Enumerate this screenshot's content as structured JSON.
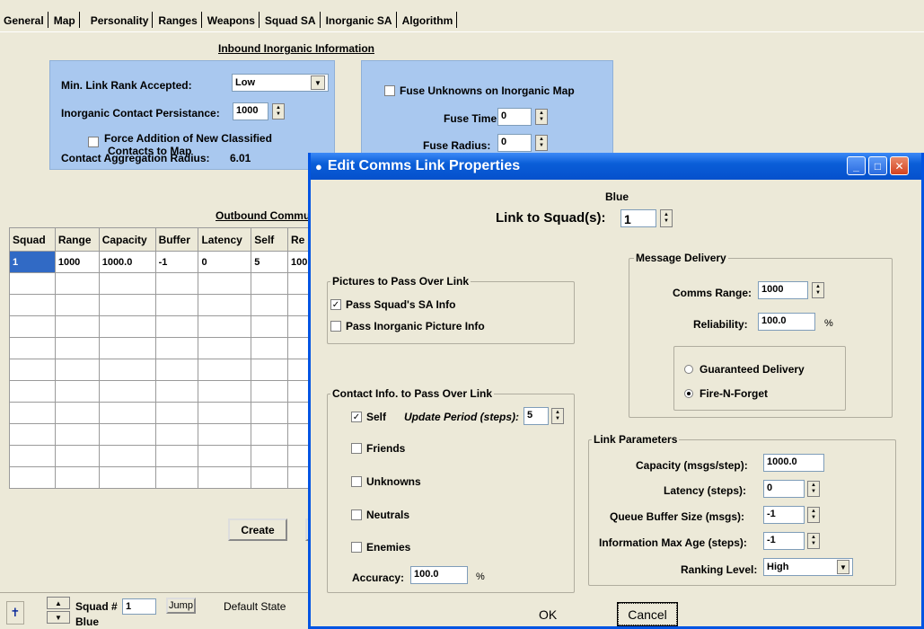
{
  "tabs": [
    "General",
    "Map",
    "Personality",
    "Ranges",
    "Weapons",
    "Squad SA",
    "Inorganic SA",
    "Algorithm"
  ],
  "active_tab": "Inorganic SA",
  "inbound": {
    "title": "Inbound Inorganic Information",
    "min_link_rank_label": "Min. Link Rank  Accepted:",
    "min_link_rank_value": "Low",
    "persistance_label": "Inorganic Contact Persistance:",
    "persistance_value": "1000",
    "force_addition_label_1": "Force Addition of New Classified",
    "force_addition_label_2": "Contacts to Map",
    "aggregation_label": "Contact Aggregation Radius:",
    "aggregation_value": "6.01",
    "fuse_unknowns_label": "Fuse Unknowns on Inorganic Map",
    "fuse_time_label": "Fuse Time:",
    "fuse_time_value": "0",
    "fuse_radius_label": "Fuse Radius:",
    "fuse_radius_value": "0"
  },
  "outbound": {
    "title": "Outbound Commu",
    "columns": [
      "Squad",
      "Range",
      "Capacity",
      "Buffer",
      "Latency",
      "Self",
      "Re"
    ],
    "rows": [
      [
        "1",
        "1000",
        "1000.0",
        "-1",
        "0",
        "5",
        "100"
      ]
    ],
    "create_button": "Create"
  },
  "status": {
    "squad_label": "Squad #",
    "squad_value": "1",
    "jump_button": "Jump",
    "default_state": "Default State",
    "team": "Blue"
  },
  "dialog": {
    "title": "Edit Comms Link Properties",
    "team": "Blue",
    "link_label": "Link to Squad(s):",
    "link_value": "1",
    "pictures": {
      "title": "Pictures to Pass Over Link",
      "pass_sa": "Pass Squad's SA Info",
      "pass_sa_checked": true,
      "pass_inorganic": "Pass Inorganic Picture Info",
      "pass_inorganic_checked": false
    },
    "contact": {
      "title": "Contact Info. to Pass Over Link",
      "self": "Self",
      "self_checked": true,
      "update_label": "Update Period (steps):",
      "update_value": "5",
      "friends": "Friends",
      "unknowns": "Unknowns",
      "neutrals": "Neutrals",
      "enemies": "Enemies",
      "accuracy_label": "Accuracy:",
      "accuracy_value": "100.0",
      "pct": "%"
    },
    "message": {
      "title": "Message Delivery",
      "range_label": "Comms Range:",
      "range_value": "1000",
      "reliability_label": "Reliability:",
      "reliability_value": "100.0",
      "pct": "%",
      "guaranteed": "Guaranteed Delivery",
      "fire_forget": "Fire-N-Forget",
      "selected": "Fire-N-Forget"
    },
    "link_params": {
      "title": "Link Parameters",
      "capacity_label": "Capacity (msgs/step):",
      "capacity_value": "1000.0",
      "latency_label": "Latency (steps):",
      "latency_value": "0",
      "queue_label": "Queue Buffer Size (msgs):",
      "queue_value": "-1",
      "max_age_label": "Information Max Age (steps):",
      "max_age_value": "-1",
      "ranking_label": "Ranking Level:",
      "ranking_value": "High"
    },
    "ok": "OK",
    "cancel": "Cancel"
  }
}
